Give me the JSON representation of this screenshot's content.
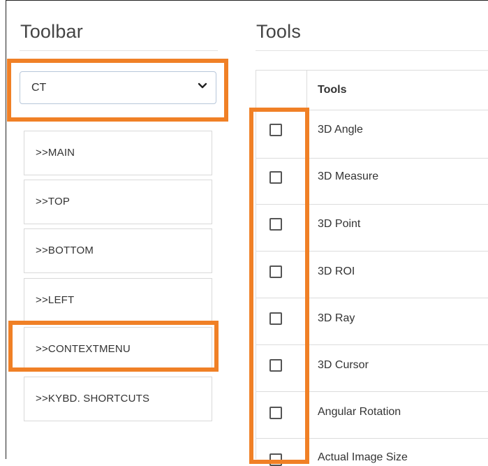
{
  "toolbar": {
    "title": "Toolbar",
    "modality_value": "CT",
    "buttons": [
      ">>MAIN",
      ">>TOP",
      ">>BOTTOM",
      ">>LEFT",
      ">>CONTEXTMENU",
      ">>KYBD. SHORTCUTS"
    ]
  },
  "tools": {
    "title": "Tools",
    "column_header": "Tools",
    "rows": [
      "3D Angle",
      "3D Measure",
      "3D Point",
      "3D ROI",
      "3D Ray",
      "3D Cursor",
      "Angular Rotation",
      "Actual Image Size"
    ]
  },
  "colors": {
    "highlight": "#f08026"
  }
}
